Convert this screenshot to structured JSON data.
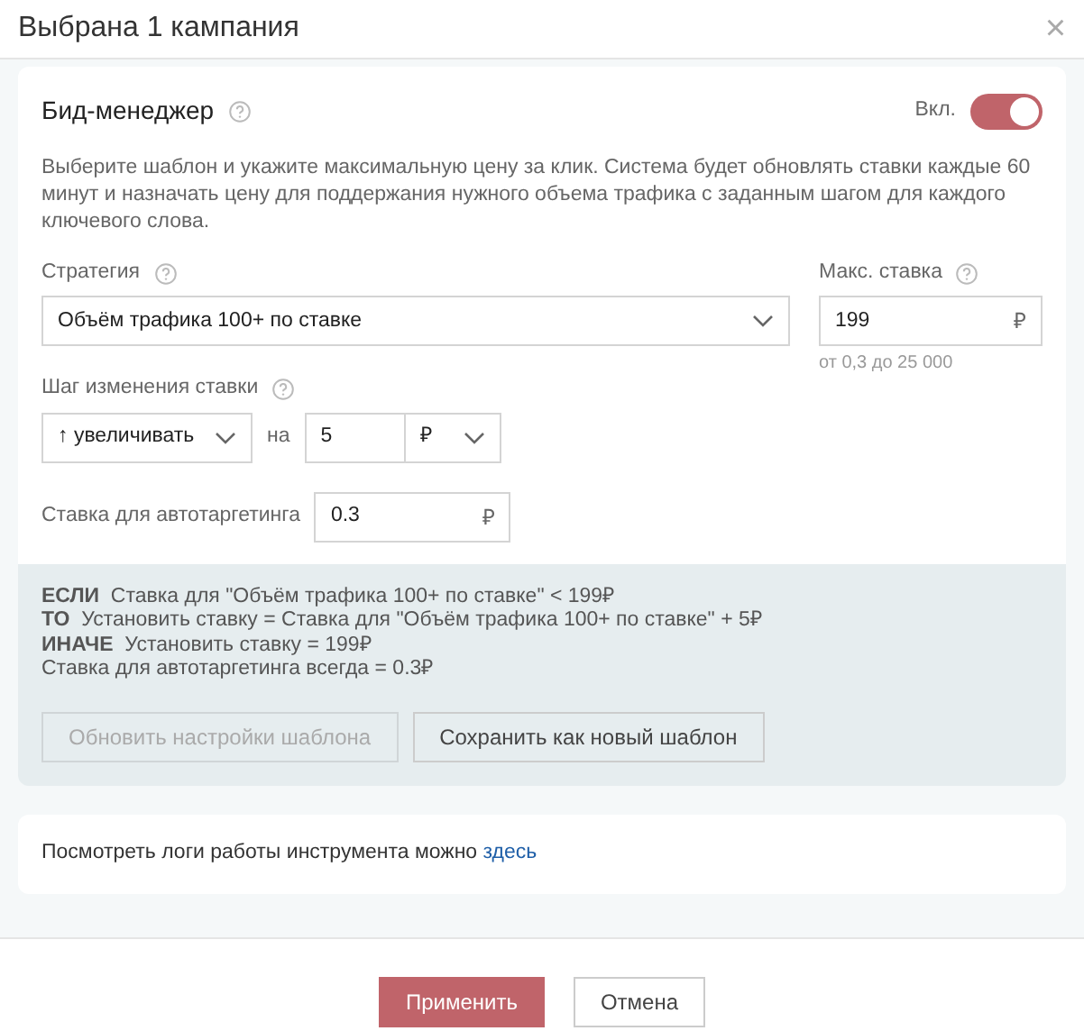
{
  "dialog": {
    "title": "Выбрана 1 кампания",
    "close": "×"
  },
  "bid_manager": {
    "title": "Бид-менеджер",
    "toggle_label": "Вкл.",
    "on": true,
    "description": "Выберите шаблон и укажите максимальную цену за клик. Система будет обновлять ставки каждые 60 минут и назначать цену для поддержания нужного объема трафика с заданным шагом для каждого ключевого слова.",
    "strategy": {
      "label": "Стратегия",
      "value": "Объём трафика 100+ по ставке"
    },
    "max_bid": {
      "label": "Макс. ставка",
      "value": "199",
      "currency": "₽",
      "hint": "от 0,3 до 25 000"
    },
    "step": {
      "label": "Шаг изменения ставки",
      "direction": "↑ увеличивать",
      "by": "на",
      "value": "5",
      "unit": "₽"
    },
    "autotargeting": {
      "label": "Ставка для автотаргетинга",
      "value": "0.3",
      "currency": "₽"
    }
  },
  "rules": [
    {
      "keyword": "ЕСЛИ",
      "text": "Ставка для \"Объём трафика 100+ по ставке\" <  199₽"
    },
    {
      "keyword": "ТО",
      "text": "Установить ставку = Ставка для \"Объём трафика 100+ по ставке\" + 5₽"
    },
    {
      "keyword": "ИНАЧЕ",
      "text": "Установить ставку =  199₽"
    },
    {
      "text": "Ставка для автотаргетинга всегда = 0.3₽"
    }
  ],
  "template_buttons": [
    {
      "label": "Обновить настройки шаблона",
      "disabled": true
    },
    {
      "label": "Сохранить как новый шаблон",
      "disabled": false
    }
  ],
  "logs": {
    "text": "Посмотреть логи работы инструмента можно",
    "link": "здесь"
  },
  "footer_buttons": [
    {
      "label": "Применить",
      "kind": "primary"
    },
    {
      "label": "Отмена",
      "kind": "secondary"
    }
  ]
}
